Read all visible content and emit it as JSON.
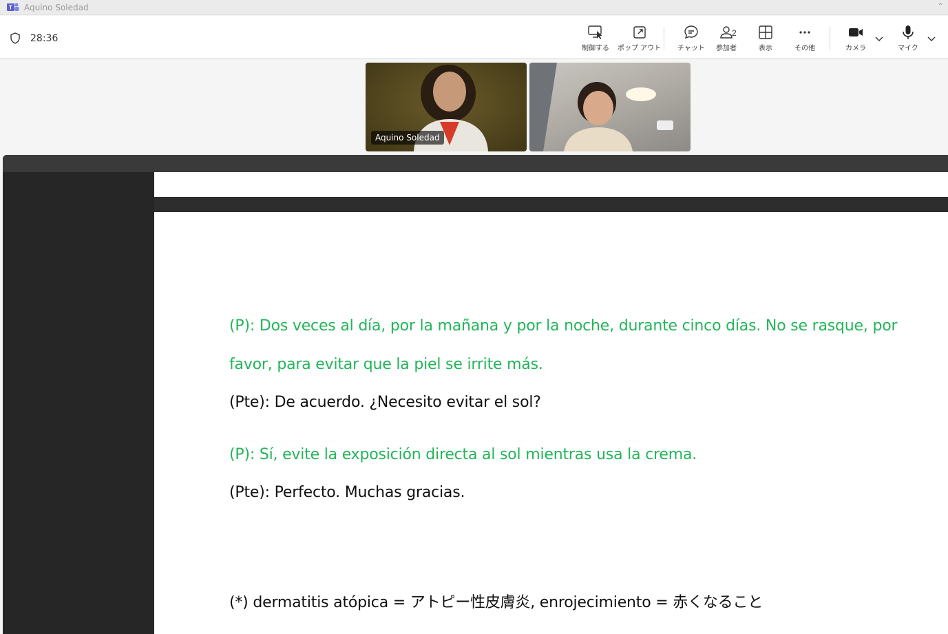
{
  "window": {
    "title": "Aquino Soledad",
    "icon": "teams-icon"
  },
  "meeting": {
    "timer": "28:36",
    "participants_count": "2"
  },
  "toolbar": {
    "buttons": [
      {
        "label": "制御する",
        "icon": "take-control-icon"
      },
      {
        "label": "ポップ アウト",
        "icon": "pop-out-icon"
      },
      {
        "label": "チャット",
        "icon": "chat-icon"
      },
      {
        "label": "参加者",
        "icon": "participants-icon"
      },
      {
        "label": "表示",
        "icon": "view-grid-icon"
      },
      {
        "label": "その他",
        "icon": "more-icon"
      },
      {
        "label": "カメラ",
        "icon": "camera-icon"
      },
      {
        "label": "マイク",
        "icon": "mic-icon"
      }
    ]
  },
  "videos": [
    {
      "name": "Aquino Soledad"
    },
    {
      "name": ""
    }
  ],
  "document": {
    "lines": [
      {
        "text": "(P): Dos veces al día, por la mañana y por la noche, durante cinco días. No se rasque, por",
        "color": "#22b559"
      },
      {
        "text": "favor, para evitar que la piel se irrite más.",
        "color": "#22b559"
      },
      {
        "text": "(Pte): De acuerdo. ¿Necesito evitar el sol?",
        "color": "#111111"
      },
      {
        "text": "(P): Sí, evite la exposición directa al sol mientras usa la crema.",
        "color": "#22b559"
      },
      {
        "text": "(Pte): Perfecto. Muchas gracias.",
        "color": "#111111"
      },
      {
        "text": "(*) dermatitis atópica = アトピー性皮膚炎, enrojecimiento = 赤くなること",
        "color": "#111111"
      }
    ]
  }
}
